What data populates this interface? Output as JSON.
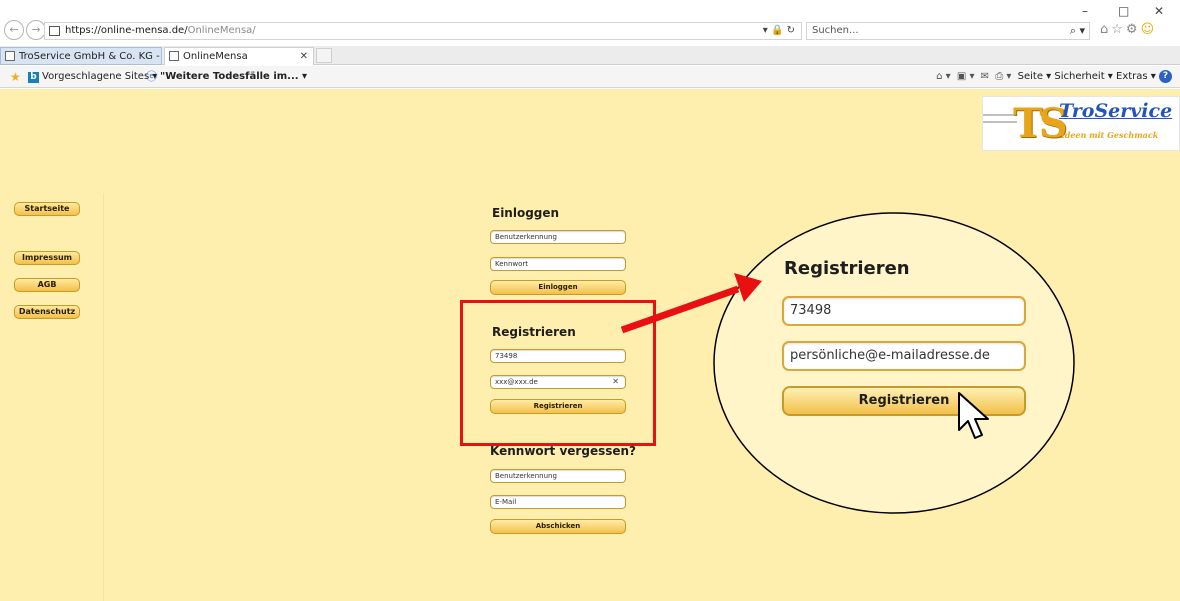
{
  "browser": {
    "url_host": "https://online-mensa.de/",
    "url_path": "OnlineMensa/",
    "search_placeholder": "Suchen...",
    "tabs": [
      {
        "label": "TroService GmbH & Co. KG - Ih..."
      },
      {
        "label": "OnlineMensa"
      }
    ],
    "favorites": {
      "suggested_sites": "Vorgeschlagene Sites ▾",
      "news_item": "\"Weitere Todesfälle im... ▾"
    },
    "command_bar": {
      "page": "Seite ▾",
      "security": "Sicherheit ▾",
      "extras": "Extras ▾",
      "help": "?"
    }
  },
  "sidebar": {
    "items": [
      {
        "label": "Startseite"
      },
      {
        "label": "Impressum"
      },
      {
        "label": "AGB"
      },
      {
        "label": "Datenschutz"
      }
    ]
  },
  "logo": {
    "monogram": "TS",
    "brand": "TroService",
    "slogan": "Ideen mit Geschmack"
  },
  "login": {
    "heading": "Einloggen",
    "username_placeholder": "Benutzerkennung",
    "password_placeholder": "Kennwort",
    "button_label": "Einloggen"
  },
  "register": {
    "heading": "Registrieren",
    "id_value": "73498",
    "email_value": "xxx@xxx.de",
    "button_label": "Registrieren"
  },
  "forgot": {
    "heading": "Kennwort vergessen?",
    "username_placeholder": "Benutzerkennung",
    "email_placeholder": "E-Mail",
    "button_label": "Abschicken"
  },
  "zoom": {
    "heading": "Registrieren",
    "id_value": "73498",
    "email_value": "persönliche@e-mailadresse.de",
    "button_label": "Registrieren"
  },
  "colors": {
    "page_background": "#ffefaf",
    "highlight": "#e81010",
    "button_gold": "#f3c04a",
    "brand_blue": "#2255b8"
  }
}
